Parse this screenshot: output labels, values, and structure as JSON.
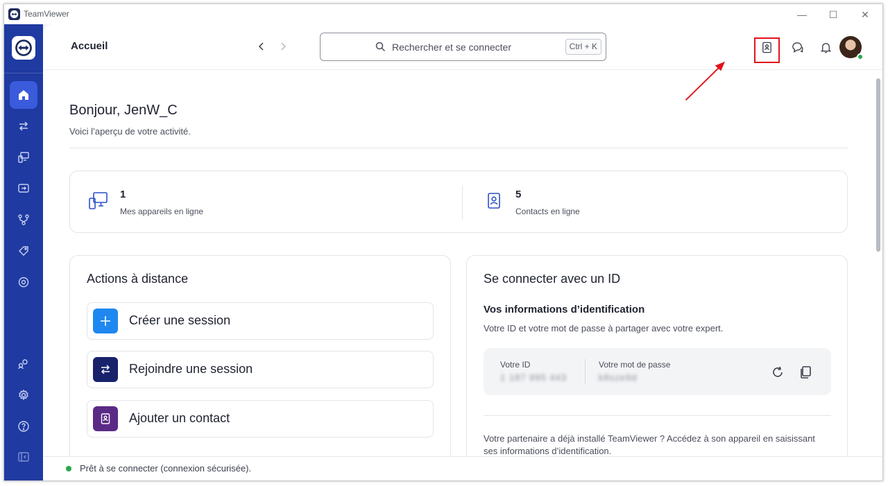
{
  "window": {
    "app_title": "TeamViewer",
    "minimize_glyph": "—",
    "maximize_glyph": "☐",
    "close_glyph": "✕"
  },
  "sidebar": {
    "items": [
      {
        "name": "home-icon",
        "active": true
      },
      {
        "name": "transfer-icon",
        "active": false
      },
      {
        "name": "devices-icon",
        "active": false
      },
      {
        "name": "remote-session-icon",
        "active": false
      },
      {
        "name": "workflow-icon",
        "active": false
      },
      {
        "name": "tag-icon",
        "active": false
      },
      {
        "name": "monitoring-icon",
        "active": false
      },
      {
        "name": "users-icon",
        "active": false
      },
      {
        "name": "gear-icon",
        "active": false
      },
      {
        "name": "help-icon",
        "active": false
      },
      {
        "name": "collapse-sidebar-icon",
        "active": false
      }
    ]
  },
  "header": {
    "title": "Accueil",
    "search_placeholder": "Rechercher et se connecter",
    "search_shortcut": "Ctrl + K",
    "icons": [
      "contacts-icon",
      "chat-icon",
      "bell-icon"
    ]
  },
  "greeting": {
    "title": "Bonjour, JenW_C",
    "subtitle": "Voici l’aperçu de votre activité."
  },
  "stats": [
    {
      "value": "1",
      "label": "Mes appareils en ligne"
    },
    {
      "value": "5",
      "label": "Contacts en ligne"
    }
  ],
  "remote_actions": {
    "title": "Actions à distance",
    "items": [
      {
        "label": "Créer une session",
        "color": "#1e88f0"
      },
      {
        "label": "Rejoindre une session",
        "color": "#17226b"
      },
      {
        "label": "Ajouter un contact",
        "color": "#5b2a86"
      }
    ]
  },
  "connect_by_id": {
    "title": "Se connecter avec un ID",
    "subtitle": "Vos informations d’identification",
    "description": "Votre ID et votre mot de passe à partager avec votre expert.",
    "id_label": "Votre ID",
    "id_value": "1 187 995 443",
    "password_label": "Votre mot de passe",
    "password_value": "k8sze9d",
    "paragraph": "Votre partenaire a déjà installé TeamViewer ? Accédez à son appareil en saisissant ses informations d’identification."
  },
  "status": {
    "text": "Prêt à se connecter (connexion sécurisée).",
    "color": "#2aa84a"
  },
  "accent_colors": {
    "sidebar": "#1f3aa0",
    "highlight": "#e0141c"
  }
}
